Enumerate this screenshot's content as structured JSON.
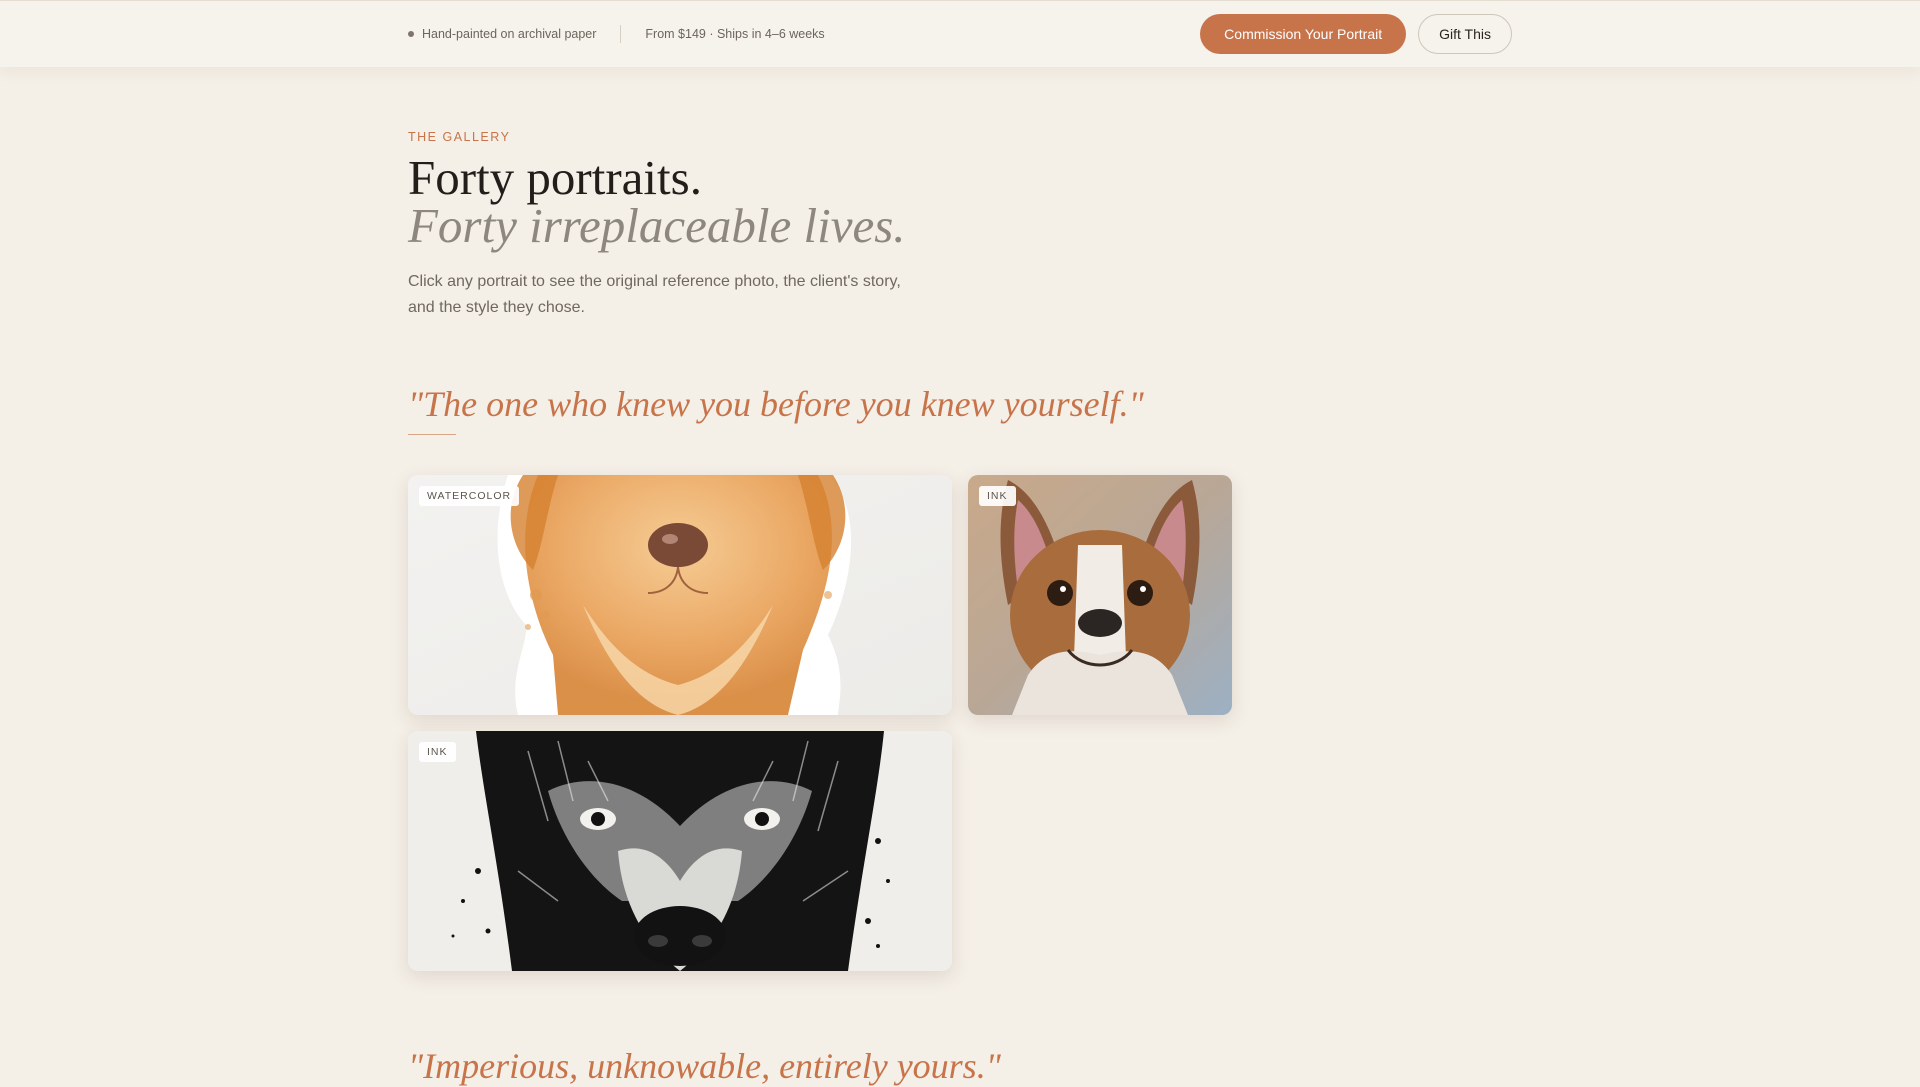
{
  "topbar": {
    "meta_left": "Hand-painted on archival paper",
    "meta_right": "From $149 · Ships in 4–6 weeks",
    "cta_primary": "Commission Your Portrait",
    "cta_secondary": "Gift This"
  },
  "hero": {
    "eyebrow": "THE GALLERY",
    "title": "Forty portraits.",
    "title_italic": "Forty irreplaceable lives.",
    "lede": "Click any portrait to see the original reference photo, the client's story, and the style they chose."
  },
  "sections": [
    {
      "quote": "\"The one who knew you before you knew yourself.\"",
      "portraits": [
        {
          "style": "WATERCOLOR",
          "subject": "golden-retriever-watercolor"
        },
        {
          "style": "INK",
          "subject": "french-bulldog-painting"
        },
        {
          "style": "INK",
          "subject": "german-shepherd-ink"
        }
      ]
    },
    {
      "quote": "\"Imperious, unknowable, entirely yours.\""
    }
  ],
  "colors": {
    "background": "#f4efe7",
    "accent": "#c8744a",
    "text": "#231e1a",
    "muted": "#8e8780"
  }
}
